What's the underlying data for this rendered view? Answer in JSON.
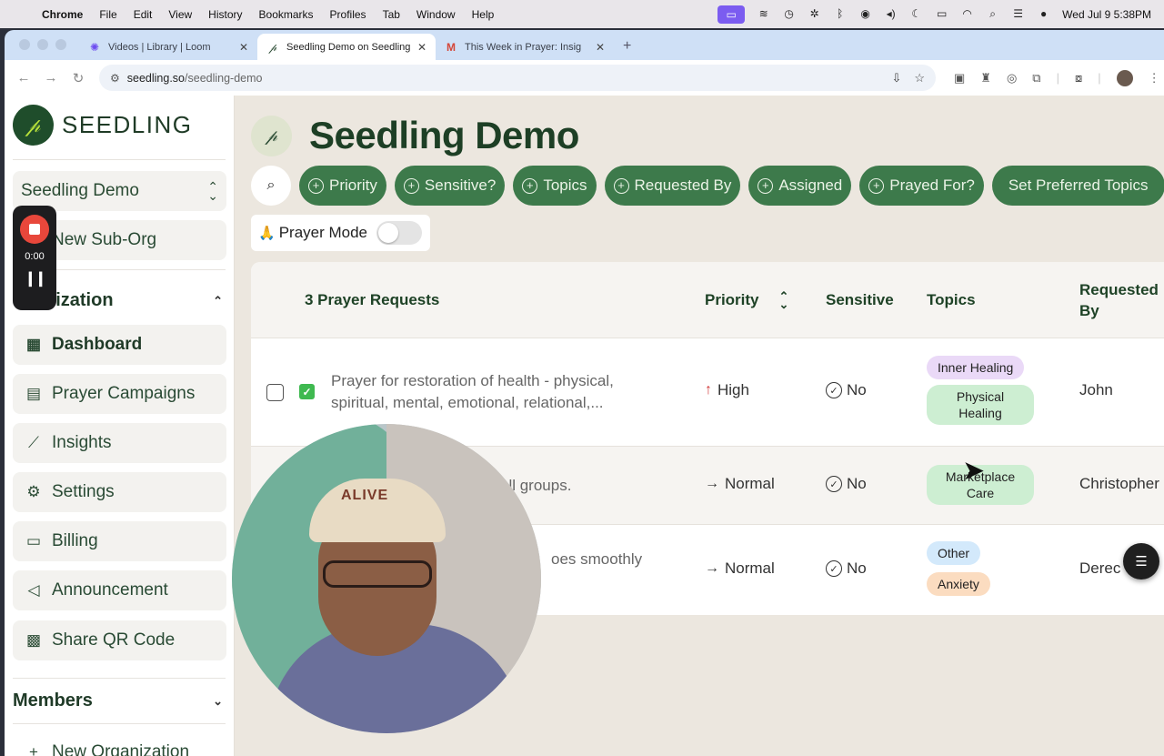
{
  "menubar": {
    "app": "Chrome",
    "items": [
      "File",
      "Edit",
      "View",
      "History",
      "Bookmarks",
      "Profiles",
      "Tab",
      "Window",
      "Help"
    ],
    "datetime": "Wed Jul 9  5:38PM"
  },
  "browser": {
    "tabs": [
      {
        "label": "Videos | Library | Loom",
        "icon": "loom-icon"
      },
      {
        "label": "Seedling Demo on Seedling",
        "icon": "seedling-icon"
      },
      {
        "label": "This Week in Prayer: Insig",
        "icon": "gmail-icon"
      }
    ],
    "url_host": "seedling.so",
    "url_path": "/seedling-demo"
  },
  "sidebar": {
    "brand": "SEEDLING",
    "org_select": "Seedling Demo",
    "new_suborg": "New Sub-Org",
    "org_section": "Organization",
    "org_section_visible": "nization",
    "items": [
      {
        "label": "Dashboard",
        "icon": "dashboard-icon"
      },
      {
        "label": "Prayer Campaigns",
        "icon": "calendar-icon"
      },
      {
        "label": "Insights",
        "icon": "chart-icon"
      },
      {
        "label": "Settings",
        "icon": "gear-icon"
      },
      {
        "label": "Billing",
        "icon": "credit-card-icon"
      },
      {
        "label": "Announcement",
        "icon": "megaphone-icon"
      },
      {
        "label": "Share QR Code",
        "icon": "qr-code-icon"
      }
    ],
    "members_section": "Members",
    "new_org": "New Organization"
  },
  "recorder": {
    "time": "0:00"
  },
  "main": {
    "title": "Seedling Demo",
    "filters": [
      "Priority",
      "Sensitive?",
      "Topics",
      "Requested By",
      "Assigned",
      "Prayed For?"
    ],
    "preferred_topics": "Set Preferred Topics",
    "prayer_mode": "Prayer Mode",
    "prayer_mode_on": false
  },
  "table": {
    "count_label": "3 Prayer Requests",
    "columns": {
      "priority": "Priority",
      "sensitive": "Sensitive",
      "topics": "Topics",
      "requested_by": "Requested By"
    },
    "rows": [
      {
        "request_line1": "Prayer for restoration of health - physical,",
        "request_line2": "spiritual, mental, emotional, relational,...",
        "priority": "High",
        "sensitive": "No",
        "topics": [
          "Inner Healing",
          "Physical Healing"
        ],
        "requested_by": "John"
      },
      {
        "request_line1": "all groups.",
        "priority": "Normal",
        "sensitive": "No",
        "topics": [
          "Marketplace Care"
        ],
        "requested_by": "Christopher"
      },
      {
        "request_line1": "oes smoothly",
        "priority": "Normal",
        "sensitive": "No",
        "topics": [
          "Other",
          "Anxiety"
        ],
        "requested_by": "Derec"
      }
    ]
  },
  "webcam": {
    "cap_text": "ALIVE"
  }
}
